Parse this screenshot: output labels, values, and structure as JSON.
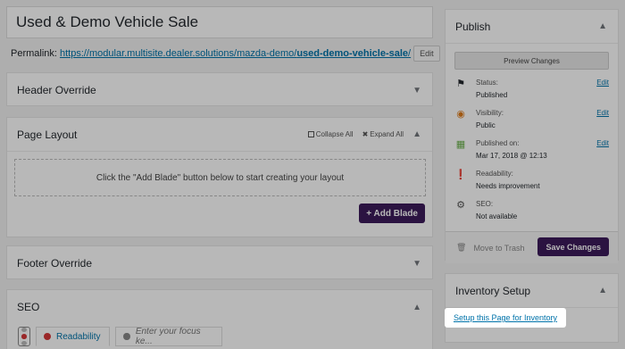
{
  "post": {
    "title": "Used & Demo Vehicle Sale",
    "permalink_label": "Permalink:",
    "permalink_base": "https://modular.multisite.dealer.solutions/mazda-demo/",
    "permalink_slug": "used-demo-vehicle-sale",
    "permalink_tail": "/",
    "edit_label": "Edit"
  },
  "sections": {
    "header_override": "Header Override",
    "page_layout": "Page Layout",
    "collapse_all": "Collapse All",
    "expand_all": "Expand All",
    "dropzone_text": "Click the \"Add Blade\" button below to start creating your layout",
    "add_blade": "+ Add Blade",
    "footer_override": "Footer Override",
    "seo": "SEO",
    "seo_tabs": {
      "readability": "Readability",
      "focus_placeholder": "Enter your focus ke..."
    }
  },
  "publish": {
    "title": "Publish",
    "preview": "Preview Changes",
    "items": [
      {
        "label": "Status:",
        "value": "Published",
        "edit": "Edit",
        "icon": "flag-icon",
        "color": "#23282d"
      },
      {
        "label": "Visibility:",
        "value": "Public",
        "edit": "Edit",
        "icon": "eye-icon",
        "color": "#dd7a1a"
      },
      {
        "label": "Published on:",
        "value": "Mar 17, 2018 @ 12:13",
        "edit": "Edit",
        "icon": "calendar-icon",
        "color": "#6ab04c"
      },
      {
        "label": "Readability:",
        "value": "Needs improvement",
        "edit": "",
        "icon": "warning-icon",
        "color": "#d63638"
      },
      {
        "label": "SEO:",
        "value": "Not available",
        "edit": "",
        "icon": "gauge-icon",
        "color": "#555555"
      }
    ],
    "trash": "Move to Trash",
    "save": "Save Changes"
  },
  "inventory": {
    "title": "Inventory Setup",
    "link": "Setup this Page for Inventory"
  },
  "colors": {
    "accent": "#3c1b5a",
    "link": "#0073aa"
  }
}
